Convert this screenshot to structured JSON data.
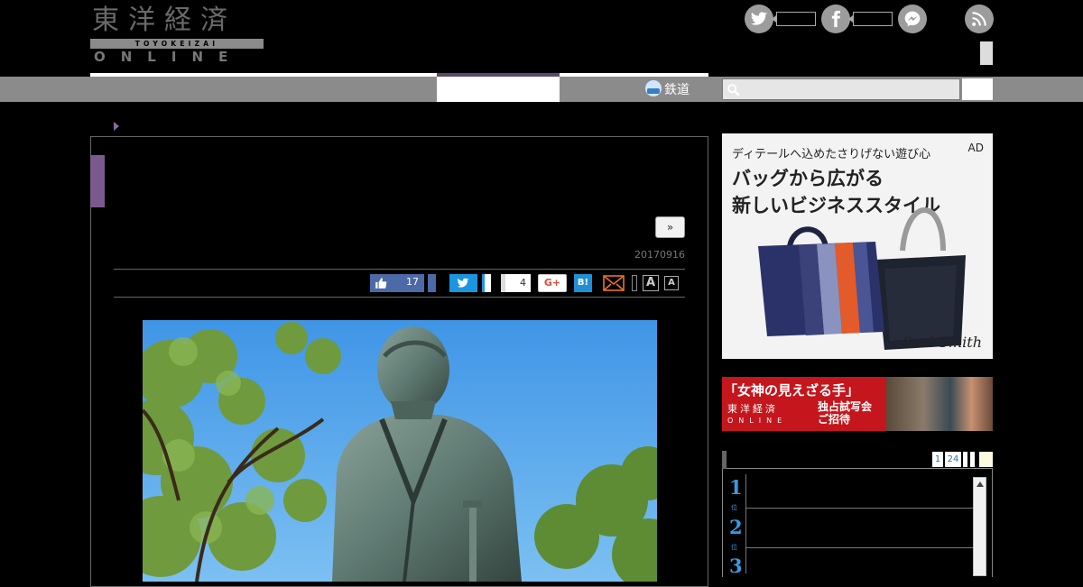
{
  "header": {
    "logo": {
      "kanji": "東洋経済",
      "romaji": "TOYOKEIZAI",
      "online": "ONLINE"
    }
  },
  "nav": {
    "rail_label": "鉄道"
  },
  "article": {
    "next_label": "»",
    "date": "20170916",
    "share": {
      "like_count": "17",
      "fb_share_count": "4",
      "gplus_label": "G+",
      "hatena_label": "B!",
      "font_large_label": "A",
      "font_small_label": "A"
    }
  },
  "sidebar": {
    "ad1": {
      "badge": "AD",
      "tagline": "ディテールへ込めたさりげない遊び心",
      "headline_1": "バッグから広がる",
      "headline_2": "新しいビジネススタイル",
      "brand": "Paul Smith"
    },
    "ad2": {
      "title": "「女神の見えざる手」",
      "logo_kanji": "東洋経済",
      "logo_online": "ONLINE",
      "offer_1": "独占試写会",
      "offer_2": "ご招待"
    },
    "ranking": {
      "pages": [
        "1",
        "24"
      ],
      "items": [
        {
          "rank": "1",
          "suffix": "位"
        },
        {
          "rank": "2",
          "suffix": "位"
        },
        {
          "rank": "3",
          "suffix": "位"
        }
      ]
    }
  },
  "colors": {
    "accent_purple": "#7a5a8e",
    "nav_gray": "#8b8b8b",
    "twitter_blue": "#1b95e0",
    "facebook_blue": "#4c69a8",
    "ranking_blue": "#3a9ae0",
    "ad_red": "#c4161c"
  }
}
